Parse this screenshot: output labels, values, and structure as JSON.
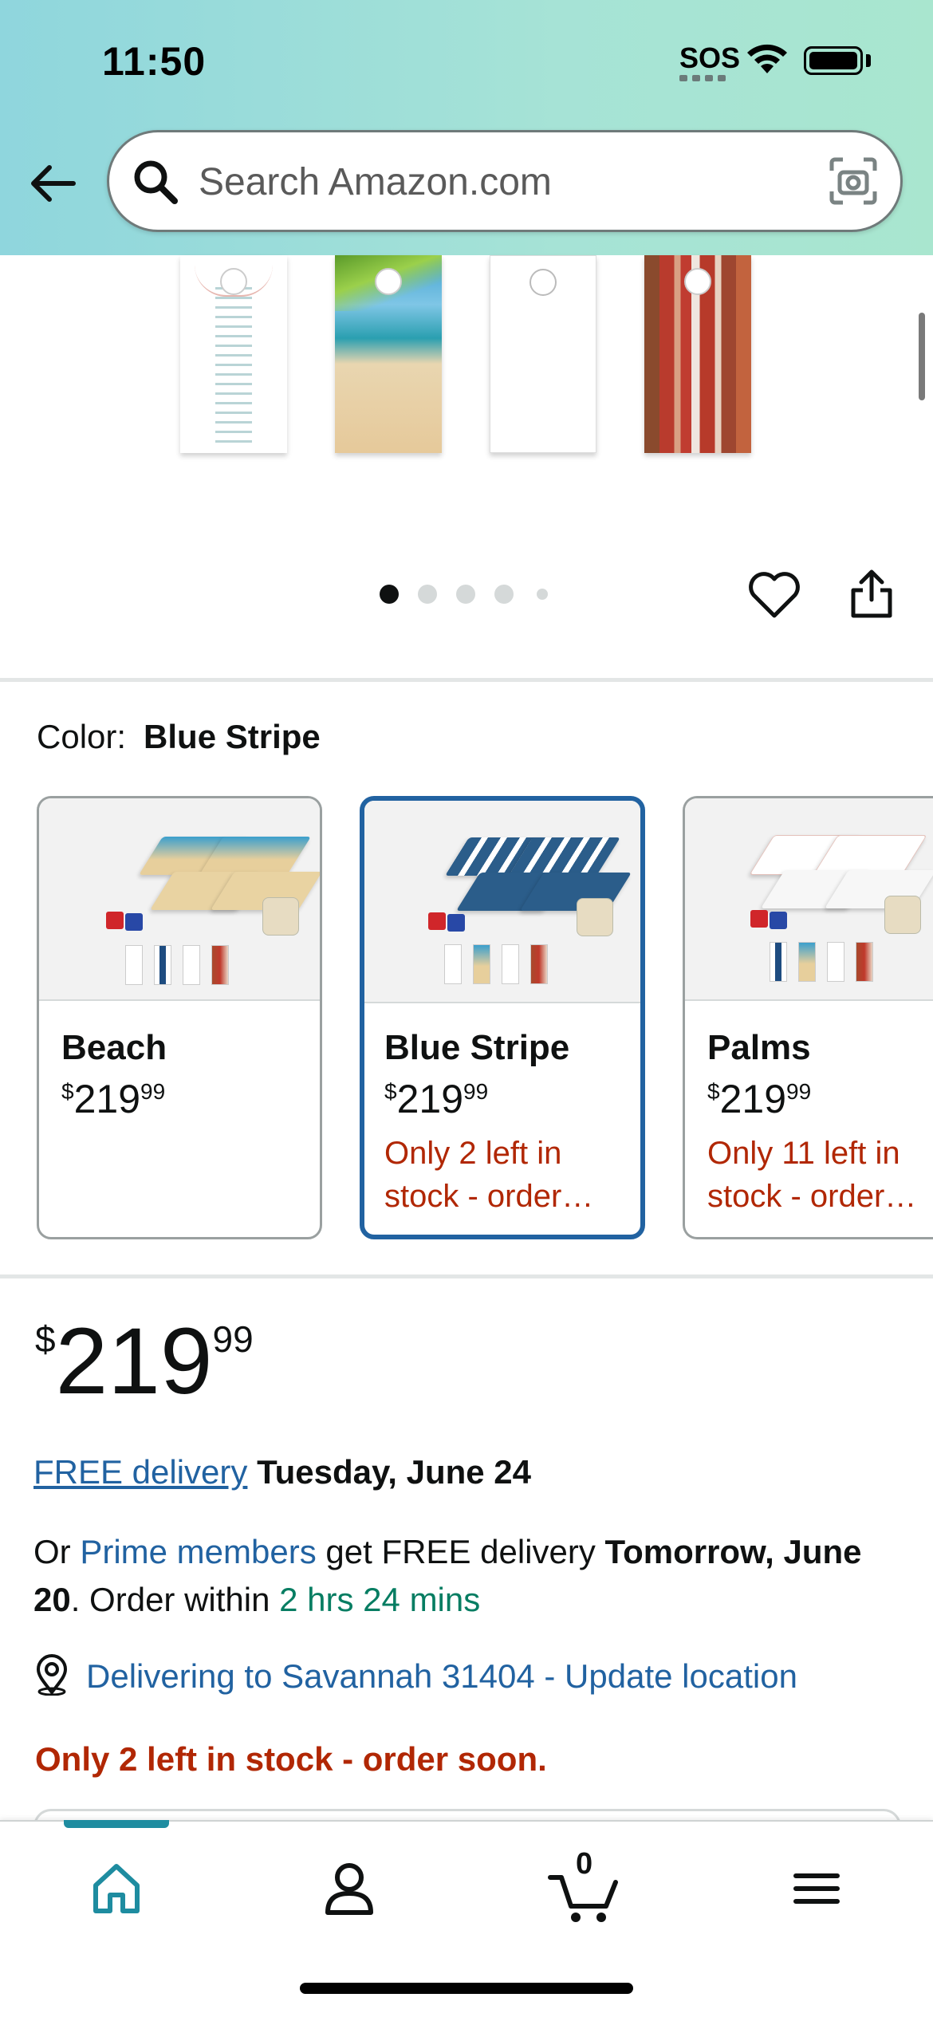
{
  "status_bar": {
    "time": "11:50",
    "sos": "SOS"
  },
  "search": {
    "placeholder": "Search Amazon.com"
  },
  "icons": {
    "back": "back-arrow-icon",
    "search": "search-icon",
    "camera": "camera-icon",
    "heart": "heart-icon",
    "share": "share-icon",
    "pin": "location-pin-icon",
    "home": "home-icon",
    "account": "account-icon",
    "cart": "cart-icon",
    "menu": "menu-icon"
  },
  "carousel": {
    "dot_count": 5,
    "active_index": 0
  },
  "color_selector": {
    "label": "Color:",
    "selected": "Blue Stripe",
    "options": [
      {
        "name": "Beach",
        "currency": "$",
        "price_whole": "219",
        "price_cents": "99",
        "stock": ""
      },
      {
        "name": "Blue Stripe",
        "currency": "$",
        "price_whole": "219",
        "price_cents": "99",
        "stock": "Only 2 left in stock - order…"
      },
      {
        "name": "Palms",
        "currency": "$",
        "price_whole": "219",
        "price_cents": "99",
        "stock": "Only 11 left in stock - order…"
      }
    ]
  },
  "price": {
    "currency": "$",
    "whole": "219",
    "cents": "99"
  },
  "delivery": {
    "free_link": "FREE delivery",
    "free_date": "Tuesday, June 24",
    "prime_prefix": "Or",
    "prime_link": "Prime members",
    "prime_middle": "get FREE delivery",
    "prime_date": "Tomorrow, June 20",
    "order_within_prefix": ". Order within",
    "order_within": "2 hrs 24 mins",
    "location": "Delivering to Savannah 31404 - Update location"
  },
  "stock_message": "Only 2 left in stock - order soon.",
  "cart": {
    "count": "0"
  },
  "colors": {
    "header_start": "#8fd6dd",
    "header_end": "#a9e6cf",
    "link": "#2162a1",
    "stock_red": "#b12704",
    "green": "#067d62",
    "selected_border": "#2162a1",
    "nav_active": "#1e8ca0"
  }
}
